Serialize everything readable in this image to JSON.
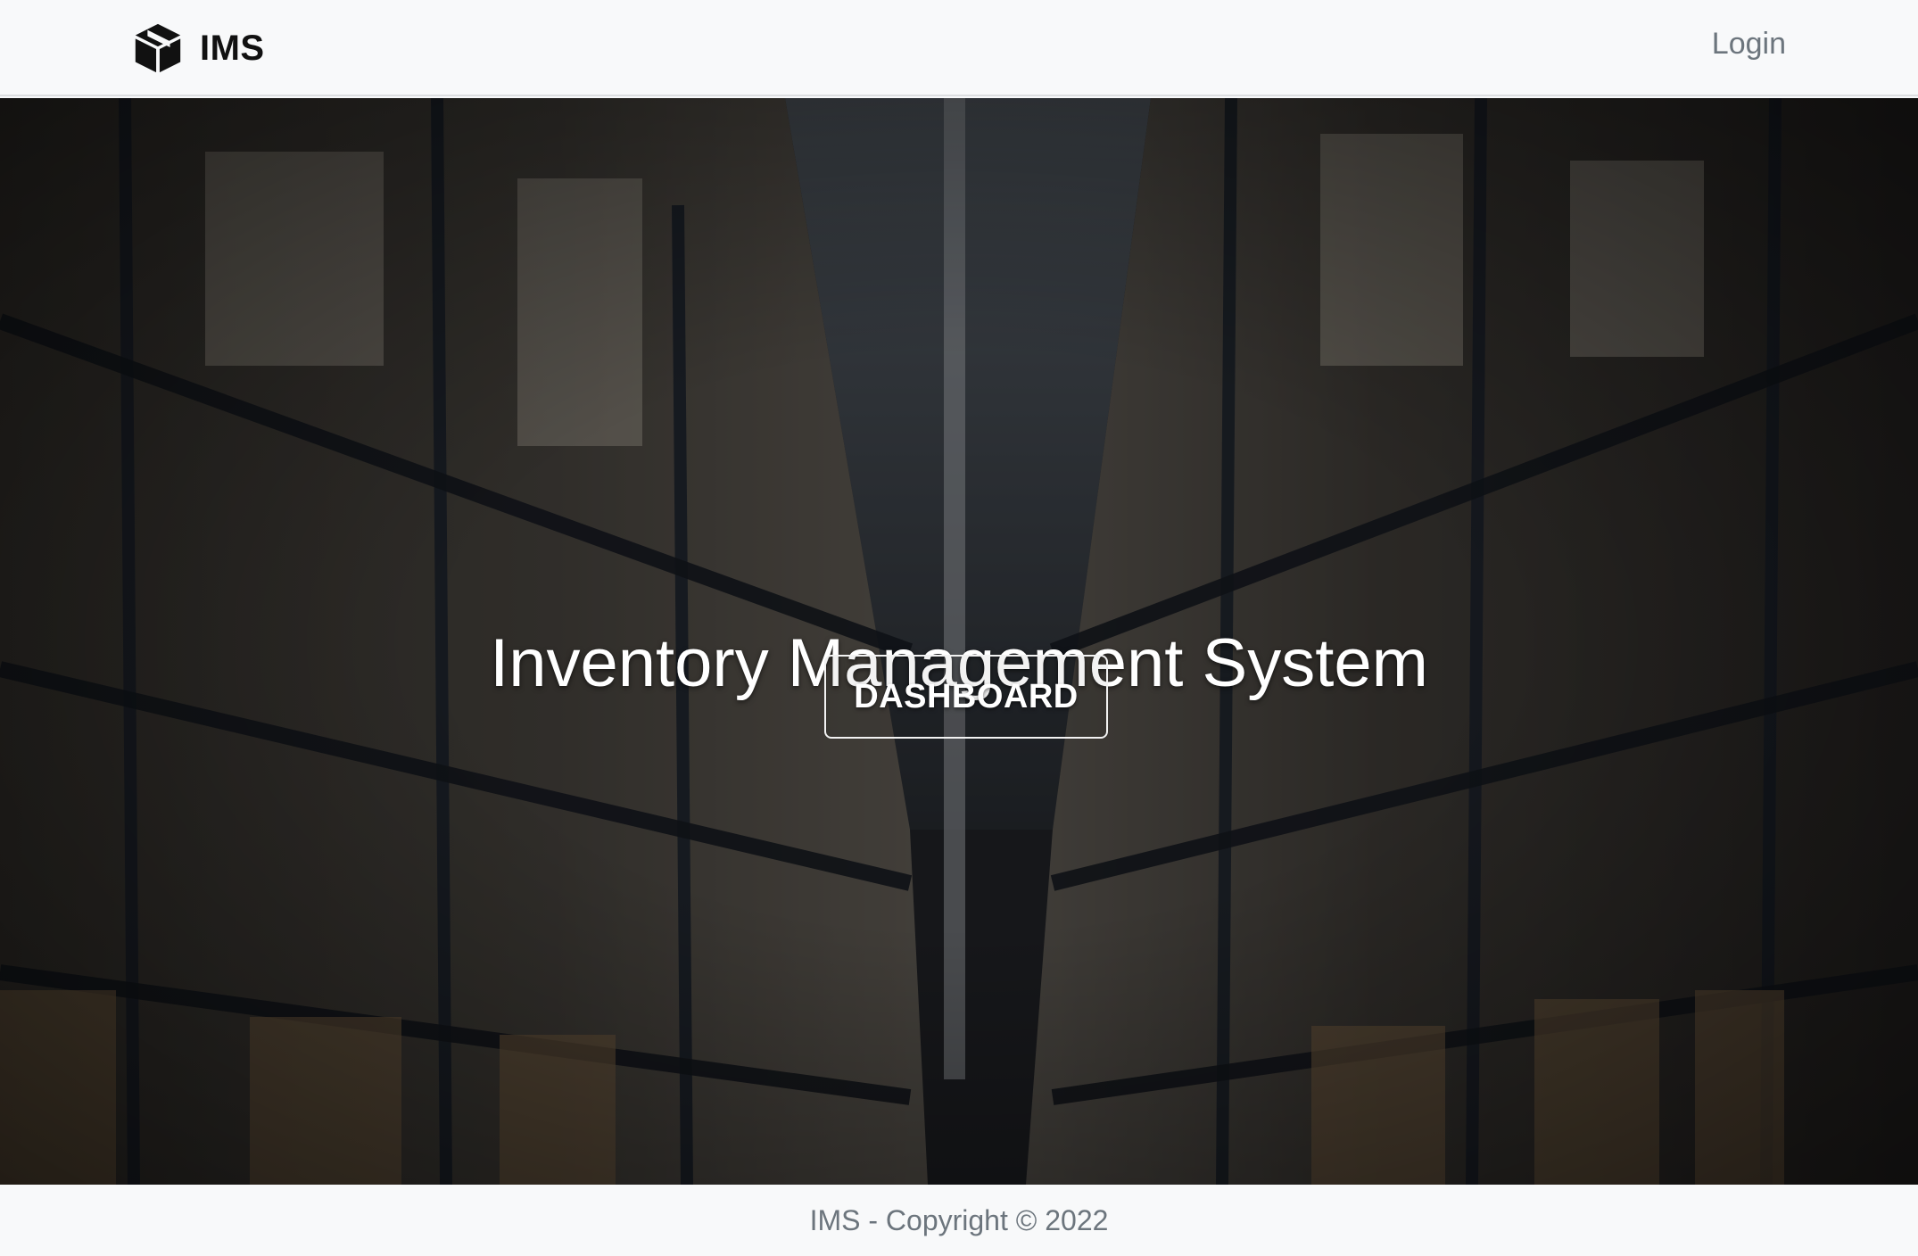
{
  "navbar": {
    "brand_icon": "box-cube-icon",
    "brand_label": "IMS",
    "login_label": "Login"
  },
  "hero": {
    "background": "warehouse-aisle-photo",
    "title": "Inventory Management System",
    "button_label": "DASHBOARD"
  },
  "footer": {
    "text": "IMS - Copyright © 2022"
  },
  "colors": {
    "navbar_bg": "#f8f9fa",
    "brand_text": "#111111",
    "muted_text": "#6c757d",
    "hero_overlay": "#1a1a1c",
    "hero_text": "#ffffff"
  }
}
